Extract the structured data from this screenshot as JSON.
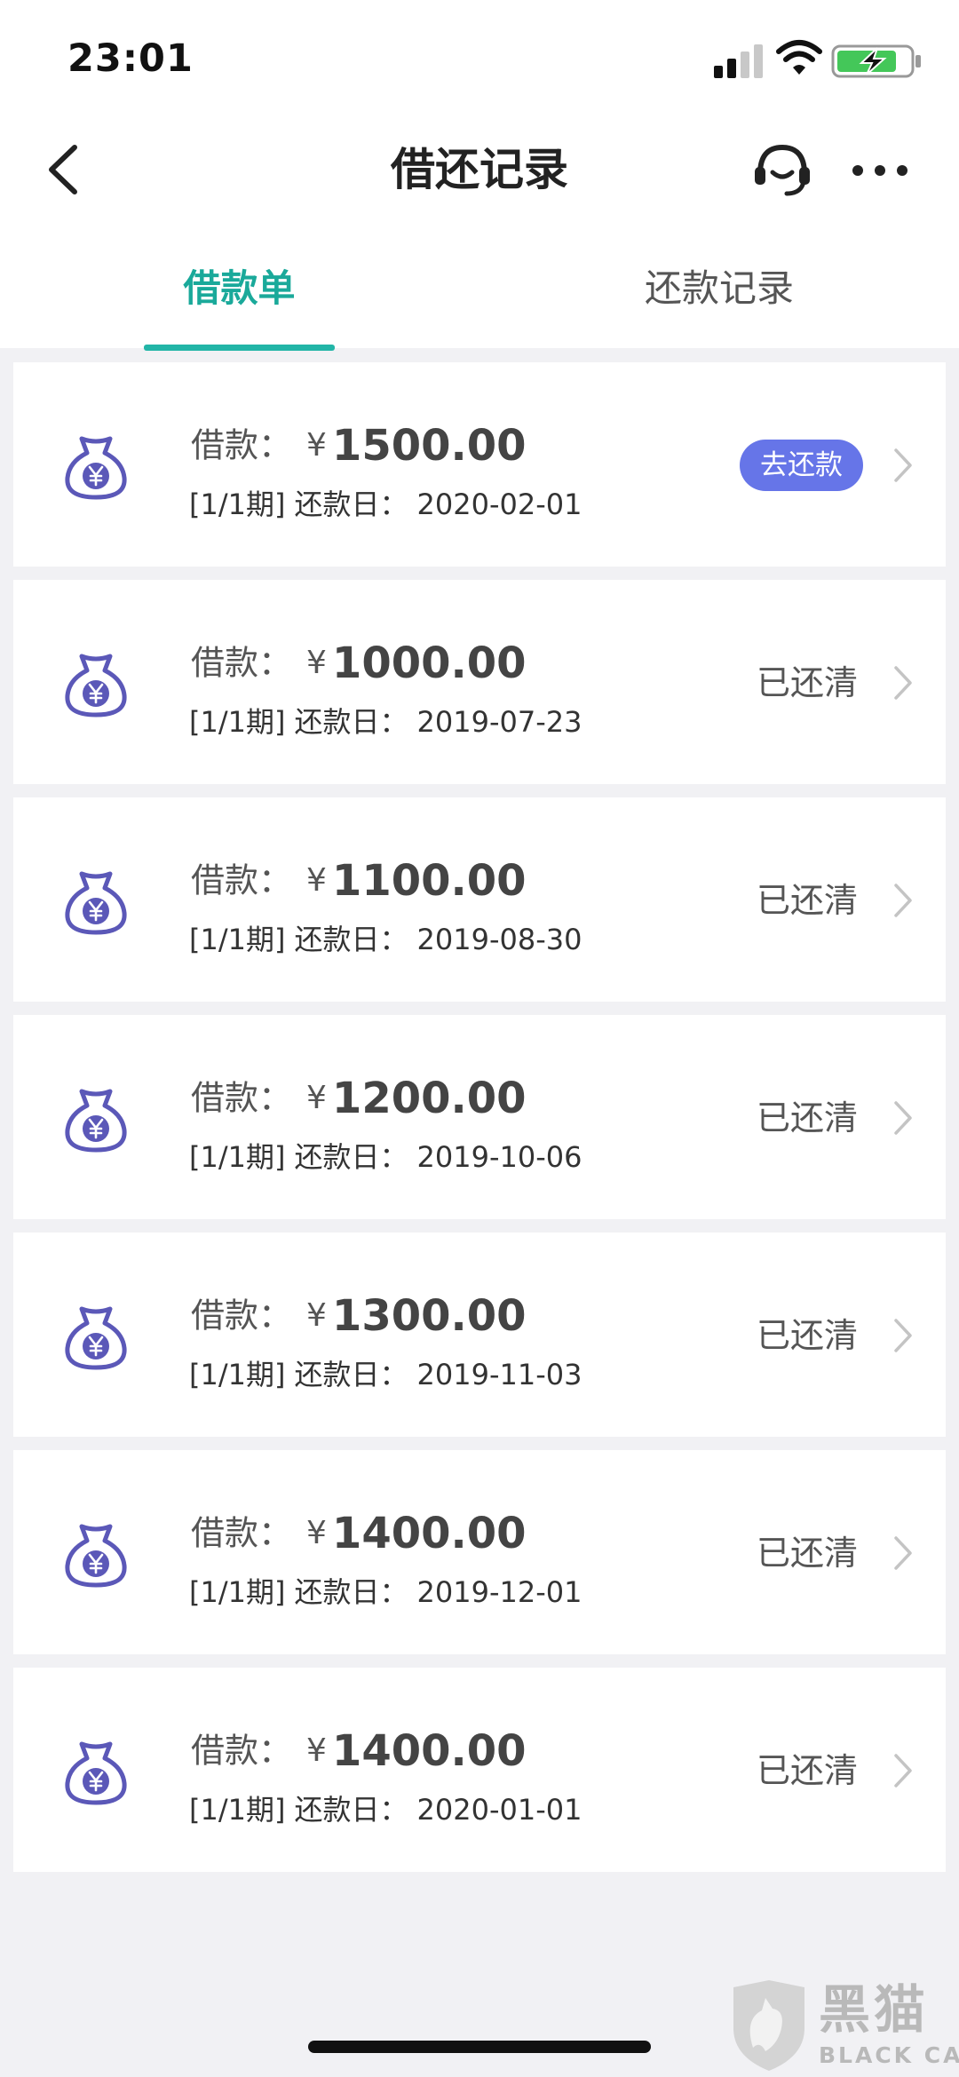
{
  "status_bar": {
    "time": "23:01",
    "signal_icon": "cellular-signal-icon",
    "wifi_icon": "wifi-icon",
    "battery_icon": "battery-charging-icon"
  },
  "nav": {
    "title": "借还记录",
    "back_icon": "chevron-left-icon",
    "service_icon": "customer-service-headset-icon",
    "more_icon": "more-dots-icon"
  },
  "tabs": [
    {
      "label": "借款单",
      "active": true
    },
    {
      "label": "还款记录",
      "active": false
    }
  ],
  "colors": {
    "accent": "#1aa99a",
    "repay_button": "#6675e8",
    "icon": "#5b58b8",
    "background": "#f1f1f4"
  },
  "loans": [
    {
      "label": "借款：",
      "currency": "¥",
      "amount": "1500.00",
      "term": "[1/1期]",
      "due_label": "还款日：",
      "due_date": "2020-02-01",
      "status": "去还款",
      "is_action": true
    },
    {
      "label": "借款：",
      "currency": "¥",
      "amount": "1000.00",
      "term": "[1/1期]",
      "due_label": "还款日：",
      "due_date": "2019-07-23",
      "status": "已还清",
      "is_action": false
    },
    {
      "label": "借款：",
      "currency": "¥",
      "amount": "1100.00",
      "term": "[1/1期]",
      "due_label": "还款日：",
      "due_date": "2019-08-30",
      "status": "已还清",
      "is_action": false
    },
    {
      "label": "借款：",
      "currency": "¥",
      "amount": "1200.00",
      "term": "[1/1期]",
      "due_label": "还款日：",
      "due_date": "2019-10-06",
      "status": "已还清",
      "is_action": false
    },
    {
      "label": "借款：",
      "currency": "¥",
      "amount": "1300.00",
      "term": "[1/1期]",
      "due_label": "还款日：",
      "due_date": "2019-11-03",
      "status": "已还清",
      "is_action": false
    },
    {
      "label": "借款：",
      "currency": "¥",
      "amount": "1400.00",
      "term": "[1/1期]",
      "due_label": "还款日：",
      "due_date": "2019-12-01",
      "status": "已还清",
      "is_action": false
    },
    {
      "label": "借款：",
      "currency": "¥",
      "amount": "1400.00",
      "term": "[1/1期]",
      "due_label": "还款日：",
      "due_date": "2020-01-01",
      "status": "已还清",
      "is_action": false
    }
  ],
  "watermark": {
    "text_cn": "黑猫",
    "text_en": "BLACK CAT"
  }
}
